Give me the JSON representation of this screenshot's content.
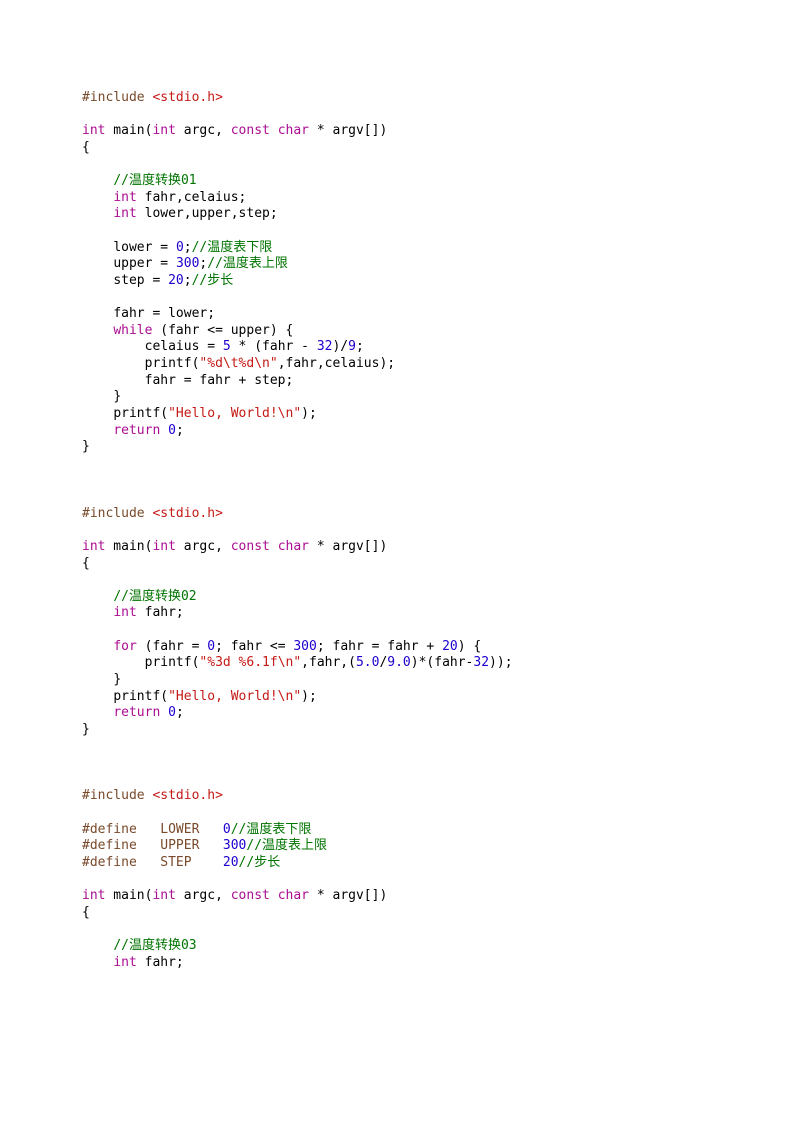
{
  "block1": {
    "l1_include": "#include",
    "l1_hdr": " <stdio.h>",
    "l3_int": "int",
    "l3_main": " main(",
    "l3_int2": "int",
    "l3_argc": " argc, ",
    "l3_const": "const",
    "l3_sp": " ",
    "l3_char": "char",
    "l3_rest": " * argv[])",
    "l4_brace": "{",
    "l6_cmt": "//温度转换01",
    "l7_int": "int",
    "l7_vars": " fahr,celaius;",
    "l8_int": "int",
    "l8_vars": " lower,upper,step;",
    "l10_a": "lower = ",
    "l10_n": "0",
    "l10_b": ";",
    "l10_cmt": "//温度表下限",
    "l11_a": "upper = ",
    "l11_n": "300",
    "l11_b": ";",
    "l11_cmt": "//温度表上限",
    "l12_a": "step = ",
    "l12_n": "20",
    "l12_b": ";",
    "l12_cmt": "//步长",
    "l14": "fahr = lower;",
    "l15_while": "while",
    "l15_rest": " (fahr <= upper) {",
    "l16_a": "celaius = ",
    "l16_n5": "5",
    "l16_b": " * (fahr - ",
    "l16_n32": "32",
    "l16_c": ")/",
    "l16_n9": "9",
    "l16_d": ";",
    "l17_a": "printf(",
    "l17_s": "\"%d\\t%d\\n\"",
    "l17_b": ",fahr,celaius);",
    "l18": "fahr = fahr + step;",
    "l19": "}",
    "l20_a": "printf(",
    "l20_s": "\"Hello, World!\\n\"",
    "l20_b": ");",
    "l21_ret": "return",
    "l21_sp": " ",
    "l21_n": "0",
    "l21_b": ";",
    "l22": "}"
  },
  "block2": {
    "l1_include": "#include",
    "l1_hdr": " <stdio.h>",
    "l3_int": "int",
    "l3_main": " main(",
    "l3_int2": "int",
    "l3_argc": " argc, ",
    "l3_const": "const",
    "l3_sp": " ",
    "l3_char": "char",
    "l3_rest": " * argv[])",
    "l4_brace": "{",
    "l6_cmt": "//温度转换02",
    "l7_int": "int",
    "l7_vars": " fahr;",
    "l9_for": "for",
    "l9_a": " (fahr = ",
    "l9_n0": "0",
    "l9_b": "; fahr <= ",
    "l9_n300": "300",
    "l9_c": "; fahr = fahr + ",
    "l9_n20": "20",
    "l9_d": ") {",
    "l10_a": "printf(",
    "l10_s": "\"%3d %6.1f\\n\"",
    "l10_b": ",fahr,(",
    "l10_n5": "5.0",
    "l10_c": "/",
    "l10_n9": "9.0",
    "l10_d": ")*(fahr-",
    "l10_n32": "32",
    "l10_e": "));",
    "l11": "}",
    "l12_a": "printf(",
    "l12_s": "\"Hello, World!\\n\"",
    "l12_b": ");",
    "l13_ret": "return",
    "l13_sp": " ",
    "l13_n": "0",
    "l13_b": ";",
    "l14": "}"
  },
  "block3": {
    "l1_include": "#include",
    "l1_hdr": " <stdio.h>",
    "l3_def": "#define   LOWER   ",
    "l3_n": "0",
    "l3_cmt": "//温度表下限",
    "l4_def": "#define   UPPER   ",
    "l4_n": "300",
    "l4_cmt": "//温度表上限",
    "l5_def": "#define   STEP    ",
    "l5_n": "20",
    "l5_cmt": "//步长",
    "l7_int": "int",
    "l7_main": " main(",
    "l7_int2": "int",
    "l7_argc": " argc, ",
    "l7_const": "const",
    "l7_sp": " ",
    "l7_char": "char",
    "l7_rest": " * argv[])",
    "l8_brace": "{",
    "l10_cmt": "//温度转换03",
    "l11_int": "int",
    "l11_vars": " fahr;"
  }
}
